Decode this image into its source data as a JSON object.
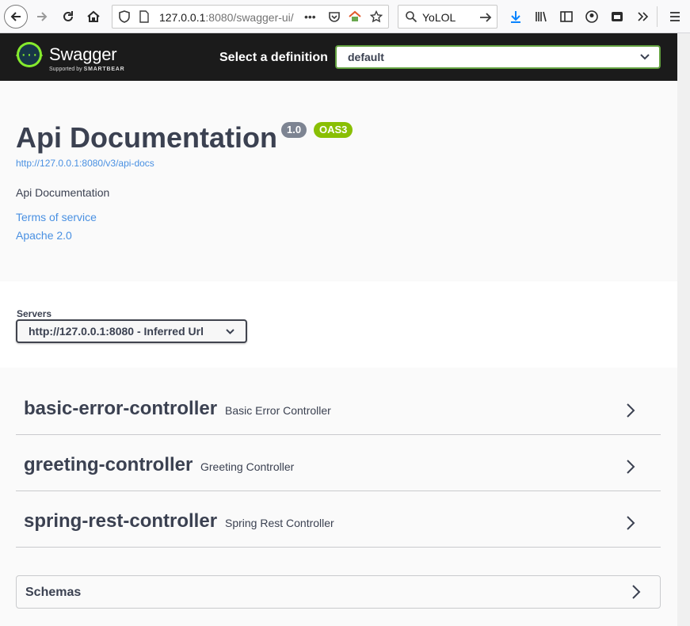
{
  "browser": {
    "url_host": "127.0.0.1",
    "url_rest": ":8080/swagger-ui/",
    "search_value": "YoLOL",
    "overflow_label": "•••"
  },
  "topbar": {
    "logo_text": "Swagger",
    "logo_symbol": "{···}",
    "logo_sub_prefix": "Supported by ",
    "logo_sub_brand": "SMARTBEAR",
    "select_label": "Select a definition",
    "definition_value": "default"
  },
  "info": {
    "title": "Api Documentation",
    "version_badge": "1.0",
    "oas_badge": "OAS3",
    "docs_url": "http://127.0.0.1:8080/v3/api-docs",
    "description": "Api Documentation",
    "terms_link": "Terms of service",
    "license_link": "Apache 2.0"
  },
  "servers": {
    "label": "Servers",
    "selected": "http://127.0.0.1:8080 - Inferred Url"
  },
  "controllers": [
    {
      "name": "basic-error-controller",
      "description": "Basic Error Controller"
    },
    {
      "name": "greeting-controller",
      "description": "Greeting Controller"
    },
    {
      "name": "spring-rest-controller",
      "description": "Spring Rest Controller"
    }
  ],
  "schemas": {
    "title": "Schemas"
  },
  "colors": {
    "topbar_bg": "#1b1b1b",
    "swagger_green": "#62a03f",
    "oas_badge": "#89bf04",
    "version_badge": "#7d8492",
    "link_blue": "#4990e2",
    "text": "#3b4151"
  }
}
